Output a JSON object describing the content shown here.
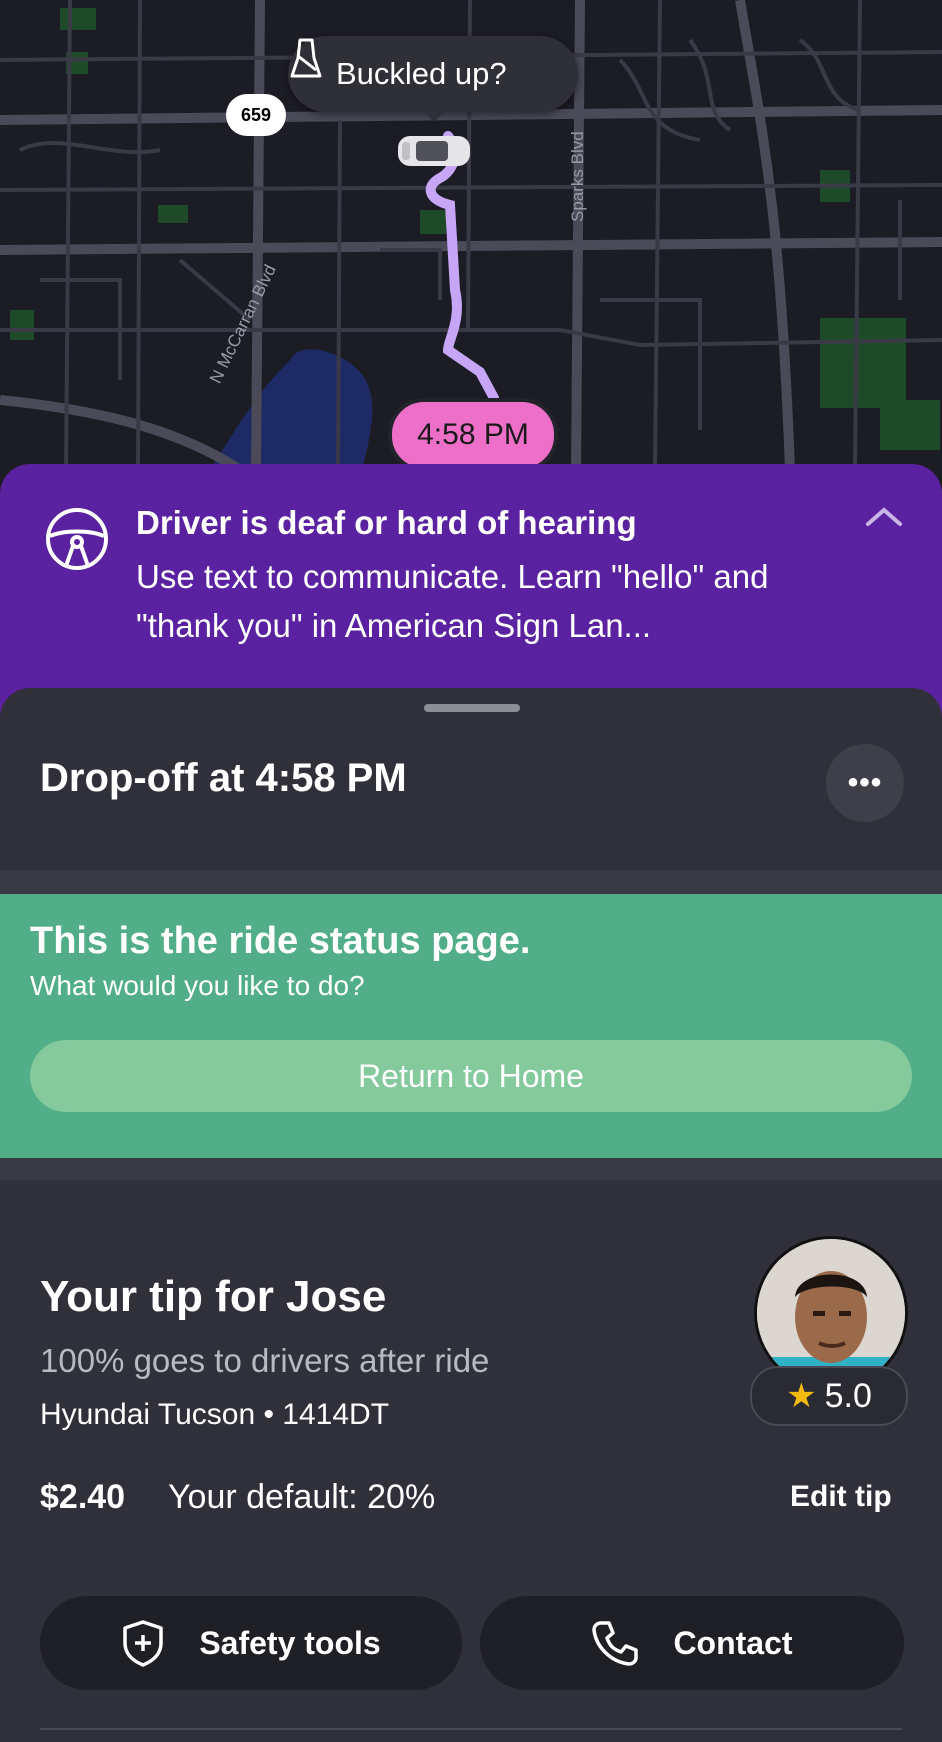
{
  "map": {
    "buckled_label": "Buckled up?",
    "route_shield": "659",
    "road_mccarran": "N McCarran Blvd",
    "road_sparks": "Sparks Blvd",
    "eta": "4:58 PM"
  },
  "banner": {
    "title": "Driver is deaf or hard of hearing",
    "body": "Use text to communicate. Learn \"hello\" and \"thank you\" in American Sign Lan...",
    "color": "#5a21a0"
  },
  "sheet": {
    "dropoff": "Drop-off at 4:58 PM",
    "more_label": "•••"
  },
  "status": {
    "title": "This is the ride status page.",
    "subtitle": "What would you like to do?",
    "button": "Return to Home",
    "color": "#52ae89"
  },
  "tip": {
    "title": "Your tip for Jose",
    "subtitle": "100% goes to drivers after ride",
    "vehicle": "Hyundai Tucson • 1414DT",
    "amount": "$2.40",
    "default_text": "Your default: 20%",
    "edit_label": "Edit tip",
    "rating": "5.0"
  },
  "actions": {
    "safety": "Safety tools",
    "contact": "Contact"
  },
  "accent_colors": {
    "eta_pill": "#ee6fc8",
    "route": "#c8a6f7"
  }
}
